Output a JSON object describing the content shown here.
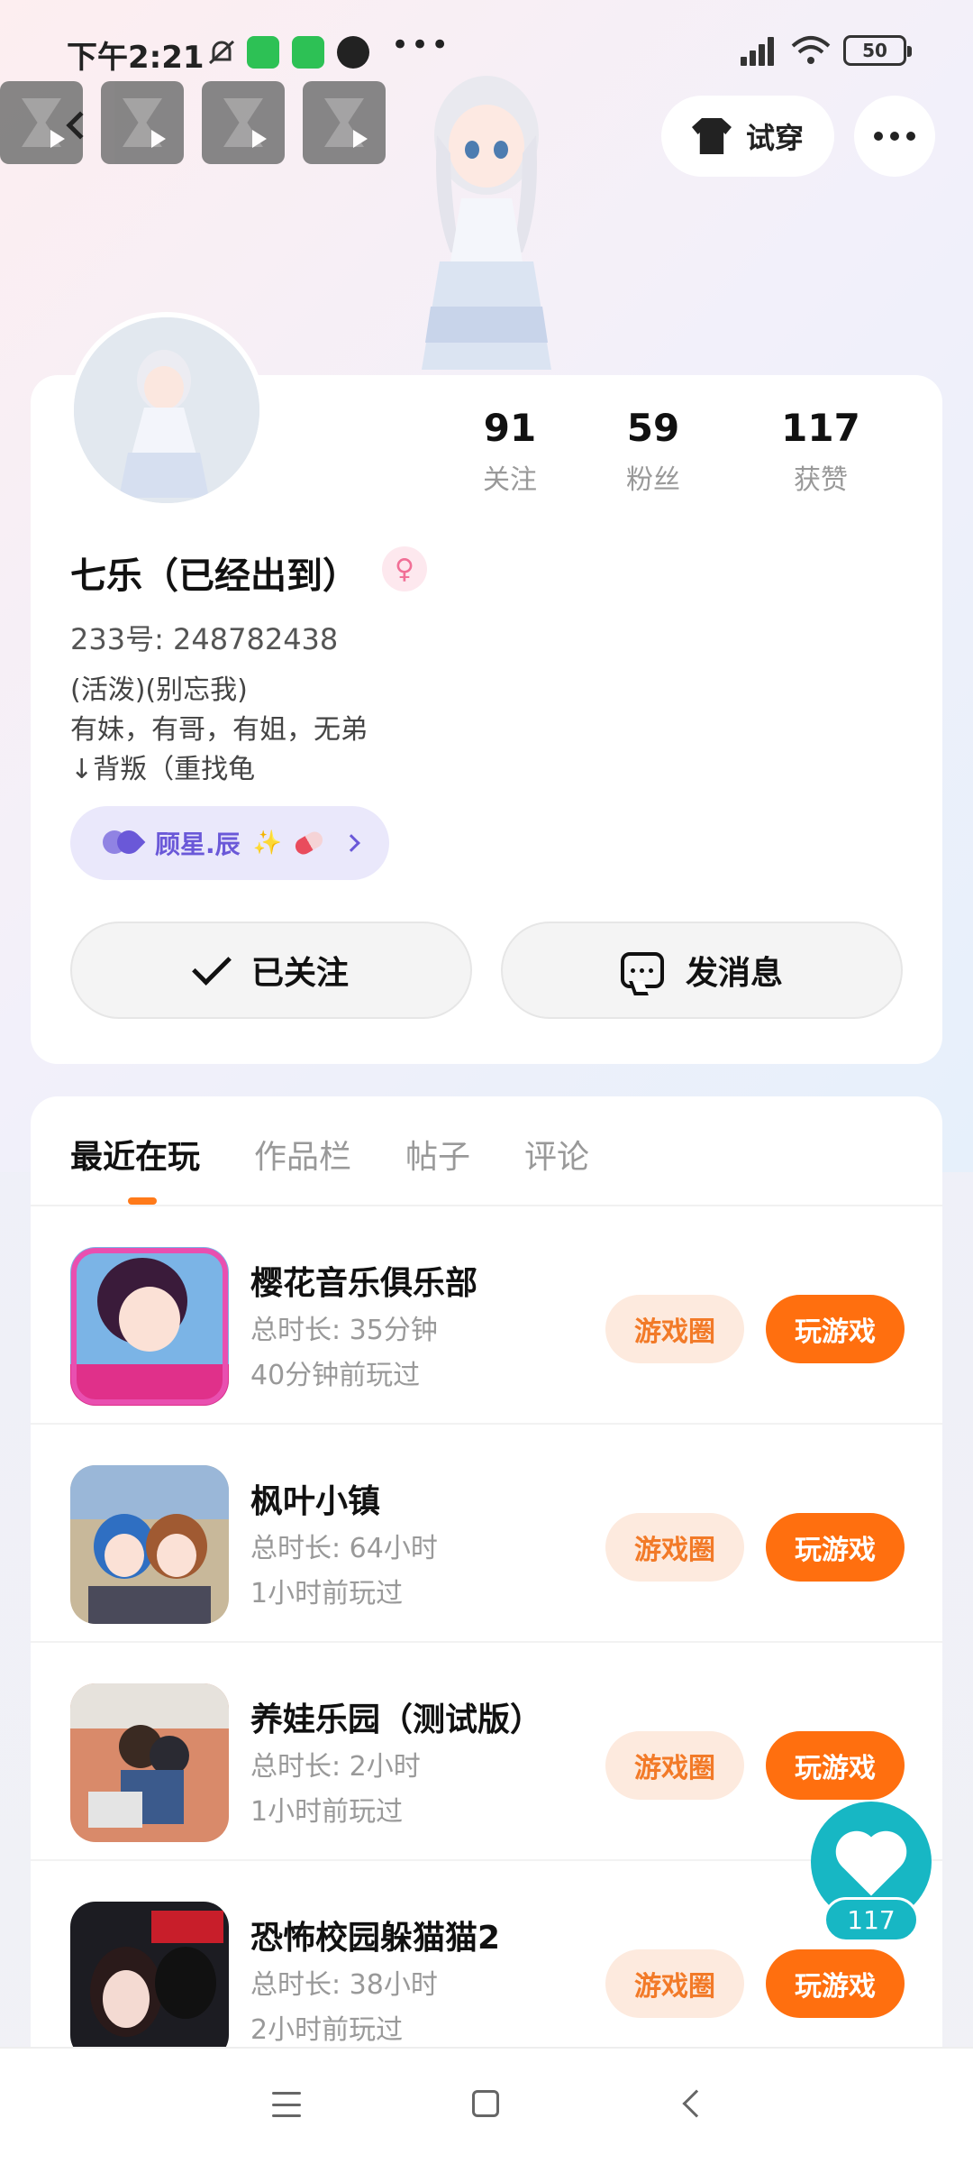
{
  "status_bar": {
    "time": "下午2:21",
    "more_label": "•••",
    "battery": "50"
  },
  "header": {
    "tryon_label": "试穿"
  },
  "profile": {
    "stats": [
      {
        "value": "91",
        "label": "关注"
      },
      {
        "value": "59",
        "label": "粉丝"
      },
      {
        "value": "117",
        "label": "获赞"
      }
    ],
    "name": "七乐（已经出到）",
    "gender_symbol": "♀",
    "user_id": "233号: 248782438",
    "bio_lines": [
      "(活泼)(别忘我)",
      "有妹，有哥，有姐，无弟",
      "↓背叛（重找龟"
    ],
    "fan_badge": {
      "name": "顾星.辰",
      "sparkle": "✨"
    },
    "follow_label": "已关注",
    "message_label": "发消息"
  },
  "tabs": [
    "最近在玩",
    "作品栏",
    "帖子",
    "评论"
  ],
  "games": [
    {
      "title": "樱花音乐俱乐部",
      "duration": "总时长: 35分钟",
      "last_played": "40分钟前玩过"
    },
    {
      "title": "枫叶小镇",
      "duration": "总时长: 64小时",
      "last_played": "1小时前玩过"
    },
    {
      "title": "养娃乐园（测试版）",
      "duration": "总时长: 2小时",
      "last_played": "1小时前玩过"
    },
    {
      "title": "恐怖校园躲猫猫2",
      "duration": "总时长: 38小时",
      "last_played": "2小时前玩过"
    }
  ],
  "game_buttons": {
    "circle": "游戏圈",
    "play": "玩游戏"
  },
  "like_count": "117",
  "colors": {
    "accent_orange": "#ff6f0f",
    "like_teal": "#17b7c4",
    "fan_purple": "#6a58d8"
  }
}
